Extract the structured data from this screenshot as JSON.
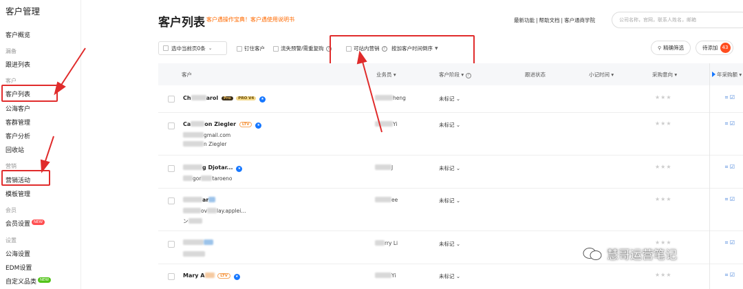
{
  "sidebar": {
    "title": "客户管理",
    "items": [
      {
        "label": "客户概览",
        "type": "item"
      },
      {
        "label": "漏备",
        "type": "group"
      },
      {
        "label": "跟进列表",
        "type": "item"
      },
      {
        "label": "客户",
        "type": "group"
      },
      {
        "label": "客户列表",
        "type": "item",
        "active": true
      },
      {
        "label": "公海客户",
        "type": "item"
      },
      {
        "label": "客群管理",
        "type": "item"
      },
      {
        "label": "客户分析",
        "type": "item"
      },
      {
        "label": "回收站",
        "type": "item"
      },
      {
        "label": "营销",
        "type": "group"
      },
      {
        "label": "营销活动",
        "type": "item",
        "highlighted": true
      },
      {
        "label": "模板管理",
        "type": "item"
      },
      {
        "label": "会员",
        "type": "group"
      },
      {
        "label": "会员设置",
        "type": "item",
        "badge": "NEW"
      },
      {
        "label": "设置",
        "type": "group"
      },
      {
        "label": "公海设置",
        "type": "item"
      },
      {
        "label": "EDM设置",
        "type": "item"
      },
      {
        "label": "自定义品类",
        "type": "item",
        "badge": "NEW"
      }
    ]
  },
  "header": {
    "title": "客户列表",
    "subtitle": "客户遇操作宝典！客户遇使用说明书",
    "links": [
      "最新功能",
      "帮助文档",
      "客户通商学院"
    ],
    "search_placeholder": "公司名称，官网，联系人姓名，邮箱"
  },
  "toolbar": {
    "select_label": "选中当前页0条",
    "filters": [
      "钉住客户",
      "流失预警/需重复购",
      "可站内营销"
    ],
    "sort_label": "按加客户时间倒序",
    "precise_filter": "精确筛选",
    "pending_label": "待添加",
    "pending_count": "43"
  },
  "table": {
    "columns": [
      "客户",
      "业务员",
      "客户阶段",
      "跟进状态",
      "小记时间",
      "采购意向",
      "年采购额"
    ],
    "rows": [
      {
        "name_a": "Ch",
        "name_b": "arol",
        "tags": [
          "Pro",
          "PRO V4"
        ],
        "owner": "heng",
        "stage": "未标记"
      },
      {
        "name_a": "Ca",
        "name_b": "on Ziegler",
        "tags": [
          "LTV"
        ],
        "sub1": "gmail.com",
        "sub2": "n Ziegler",
        "owner": "Yi",
        "stage": "未标记"
      },
      {
        "name_a": "",
        "name_b": "g Djotar...",
        "tags": [],
        "sub1": "gor",
        "sub2": "taroeno",
        "owner": "J",
        "stage": "未标记"
      },
      {
        "name_a": "",
        "name_b": "ar",
        "tags": [],
        "sub1": "ov",
        "sub2": "lay.applei...",
        "sub3": "ン",
        "owner": "ee",
        "stage": "未标记"
      },
      {
        "name_a": "",
        "name_b": "",
        "tags": [],
        "owner": "rry Li",
        "stage": "未标记"
      },
      {
        "name_a": "Mary A",
        "name_b": "",
        "tags": [
          "LTV"
        ],
        "owner": "Yi",
        "stage": "未标记"
      }
    ]
  },
  "watermark": "慧哥运营笔记"
}
